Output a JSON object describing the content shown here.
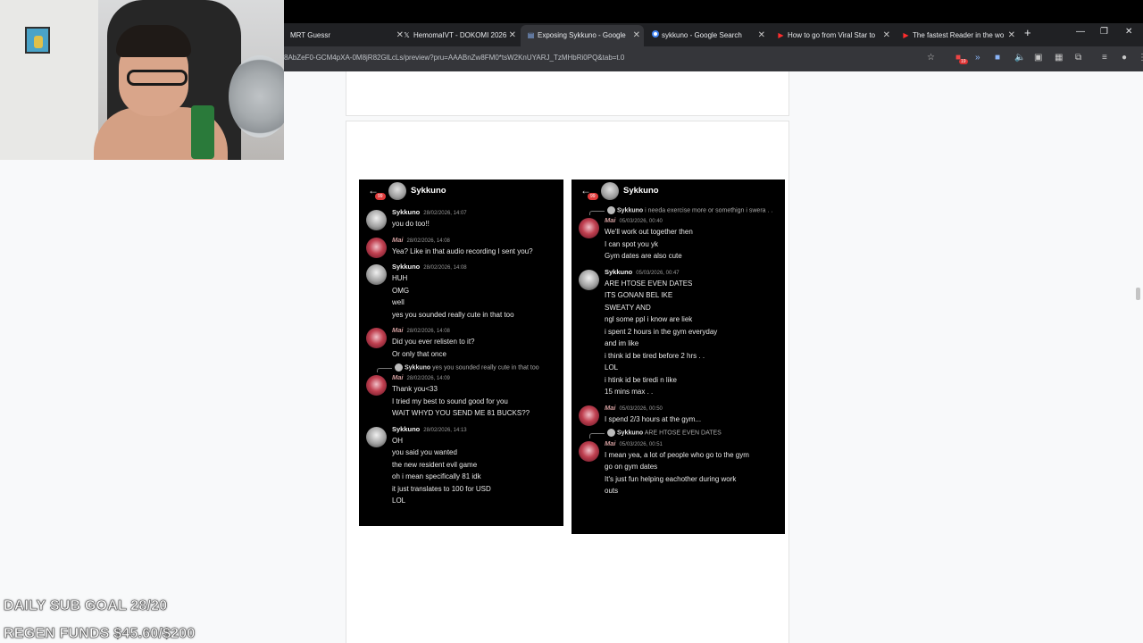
{
  "browser": {
    "tabs": [
      {
        "label": "MRT Guessr",
        "icon": "none"
      },
      {
        "label": "HemomaIVT - DOKOMI 2026",
        "icon": "x"
      },
      {
        "label": "Exposing Sykkuno - Google",
        "icon": "docs"
      },
      {
        "label": "sykkuno - Google Search",
        "icon": "google"
      },
      {
        "label": "How to go from Viral Star to",
        "icon": "youtube"
      },
      {
        "label": "The fastest Reader in the wo",
        "icon": "youtube"
      }
    ],
    "url": "8AbZeF0-GCM4pXA-0M8jR82GlLcLs/preview?pru=AAABnZw8FM0*tsW2KnUYARJ_TzMHbRi0PQ&tab=t.0",
    "ext_badge": "19"
  },
  "chat_left": {
    "header_name": "Sykkuno",
    "badge": "99",
    "messages": [
      {
        "user": "Sykkuno",
        "kind": "syk",
        "time": "28/02/2026, 14:07",
        "lines": [
          "you do too!!"
        ]
      },
      {
        "user": "Mai",
        "kind": "mai",
        "time": "28/02/2026, 14:08",
        "lines": [
          "Yea? Like in that audio recording I sent you?"
        ]
      },
      {
        "user": "Sykkuno",
        "kind": "syk",
        "time": "28/02/2026, 14:08",
        "lines": [
          "HUH",
          "OMG",
          "well",
          "yes you sounded really cute in that too"
        ]
      },
      {
        "user": "Mai",
        "kind": "mai",
        "time": "28/02/2026, 14:08",
        "lines": [
          "Did you ever relisten to it?",
          "Or only that once"
        ]
      },
      {
        "reply_user": "Sykkuno",
        "reply_text": "yes you sounded really cute in that too",
        "user": "Mai",
        "kind": "mai",
        "time": "28/02/2026, 14:09",
        "lines": [
          "Thank you<33",
          "I tried my best to sound good for you",
          "WAIT WHYD YOU SEND ME 81 BUCKS??"
        ]
      },
      {
        "user": "Sykkuno",
        "kind": "syk",
        "time": "28/02/2026, 14:13",
        "lines": [
          "OH",
          "you said you wanted",
          "the new resident evil game",
          "oh i mean specifically 81 idk",
          "it just translates to 100 for USD",
          "LOL"
        ]
      }
    ]
  },
  "chat_right": {
    "header_name": "Sykkuno",
    "badge": "99",
    "messages": [
      {
        "reply_user": "Sykkuno",
        "reply_text": "i needa exercise more or somethign i swera . .",
        "user": "Mai",
        "kind": "mai",
        "time": "05/03/2026, 00:40",
        "lines": [
          "We'll work out together then",
          "I can spot you yk",
          "Gym dates are also cute"
        ]
      },
      {
        "user": "Sykkuno",
        "kind": "syk",
        "time": "05/03/2026, 00:47",
        "lines": [
          "ARE HTOSE EVEN DATES",
          "ITS GONAN BEL IKE",
          "SWEATY AND",
          "ngl some ppl i know are liek",
          "i spent 2 hours in the gym everyday",
          "and im like",
          "i think id be tired before 2 hrs . .",
          "LOL",
          "i htink id be tiredi n like",
          "15 mins max . ."
        ]
      },
      {
        "user": "Mai",
        "kind": "mai",
        "time": "05/03/2026, 00:50",
        "lines": [
          "I spend 2/3 hours at the gym..."
        ]
      },
      {
        "reply_user": "Sykkuno",
        "reply_text": "ARE HTOSE EVEN DATES",
        "user": "Mai",
        "kind": "mai",
        "time": "05/03/2026, 00:51",
        "lines": [
          "I mean yea, a lot of people who go to the gym",
          "go on gym dates",
          "It's just fun helping eachother during work",
          "outs"
        ]
      }
    ]
  },
  "overlay": {
    "sub_goal": "DAILY SUB GOAL 28/20",
    "regen_funds": "REGEN FUNDS $45.60/$200"
  },
  "colors": {
    "tab_bar": "#202124",
    "active_tab": "#35363a",
    "page_bg": "#f8f9fa",
    "chat_bg": "#000000"
  }
}
